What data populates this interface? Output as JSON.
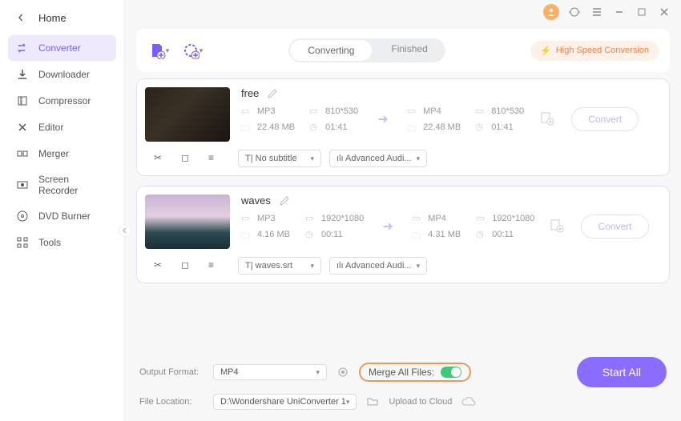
{
  "sidebar": {
    "title": "Home",
    "items": [
      {
        "label": "Converter",
        "icon": "convert"
      },
      {
        "label": "Downloader",
        "icon": "download"
      },
      {
        "label": "Compressor",
        "icon": "compress"
      },
      {
        "label": "Editor",
        "icon": "editor"
      },
      {
        "label": "Merger",
        "icon": "merger"
      },
      {
        "label": "Screen Recorder",
        "icon": "recorder"
      },
      {
        "label": "DVD Burner",
        "icon": "dvd"
      },
      {
        "label": "Tools",
        "icon": "tools"
      }
    ]
  },
  "tabs": {
    "converting": "Converting",
    "finished": "Finished"
  },
  "high_speed_label": "High Speed Conversion",
  "files": [
    {
      "title": "free",
      "src": {
        "format": "MP3",
        "res": "810*530",
        "size": "22.48 MB",
        "dur": "01:41"
      },
      "dst": {
        "format": "MP4",
        "res": "810*530",
        "size": "22.48 MB",
        "dur": "01:41"
      },
      "subtitle": "No subtitle",
      "audio": "Advanced Audi...",
      "convert_label": "Convert"
    },
    {
      "title": "waves",
      "src": {
        "format": "MP3",
        "res": "1920*1080",
        "size": "4.16 MB",
        "dur": "00:11"
      },
      "dst": {
        "format": "MP4",
        "res": "1920*1080",
        "size": "4.31 MB",
        "dur": "00:11"
      },
      "subtitle": "waves.srt",
      "audio": "Advanced Audi...",
      "convert_label": "Convert"
    }
  ],
  "footer": {
    "output_format_label": "Output Format:",
    "output_format_value": "MP4",
    "merge_label": "Merge All Files:",
    "file_location_label": "File Location:",
    "file_location_value": "D:\\Wondershare UniConverter 1",
    "upload_cloud_label": "Upload to Cloud",
    "start_all_label": "Start All"
  }
}
